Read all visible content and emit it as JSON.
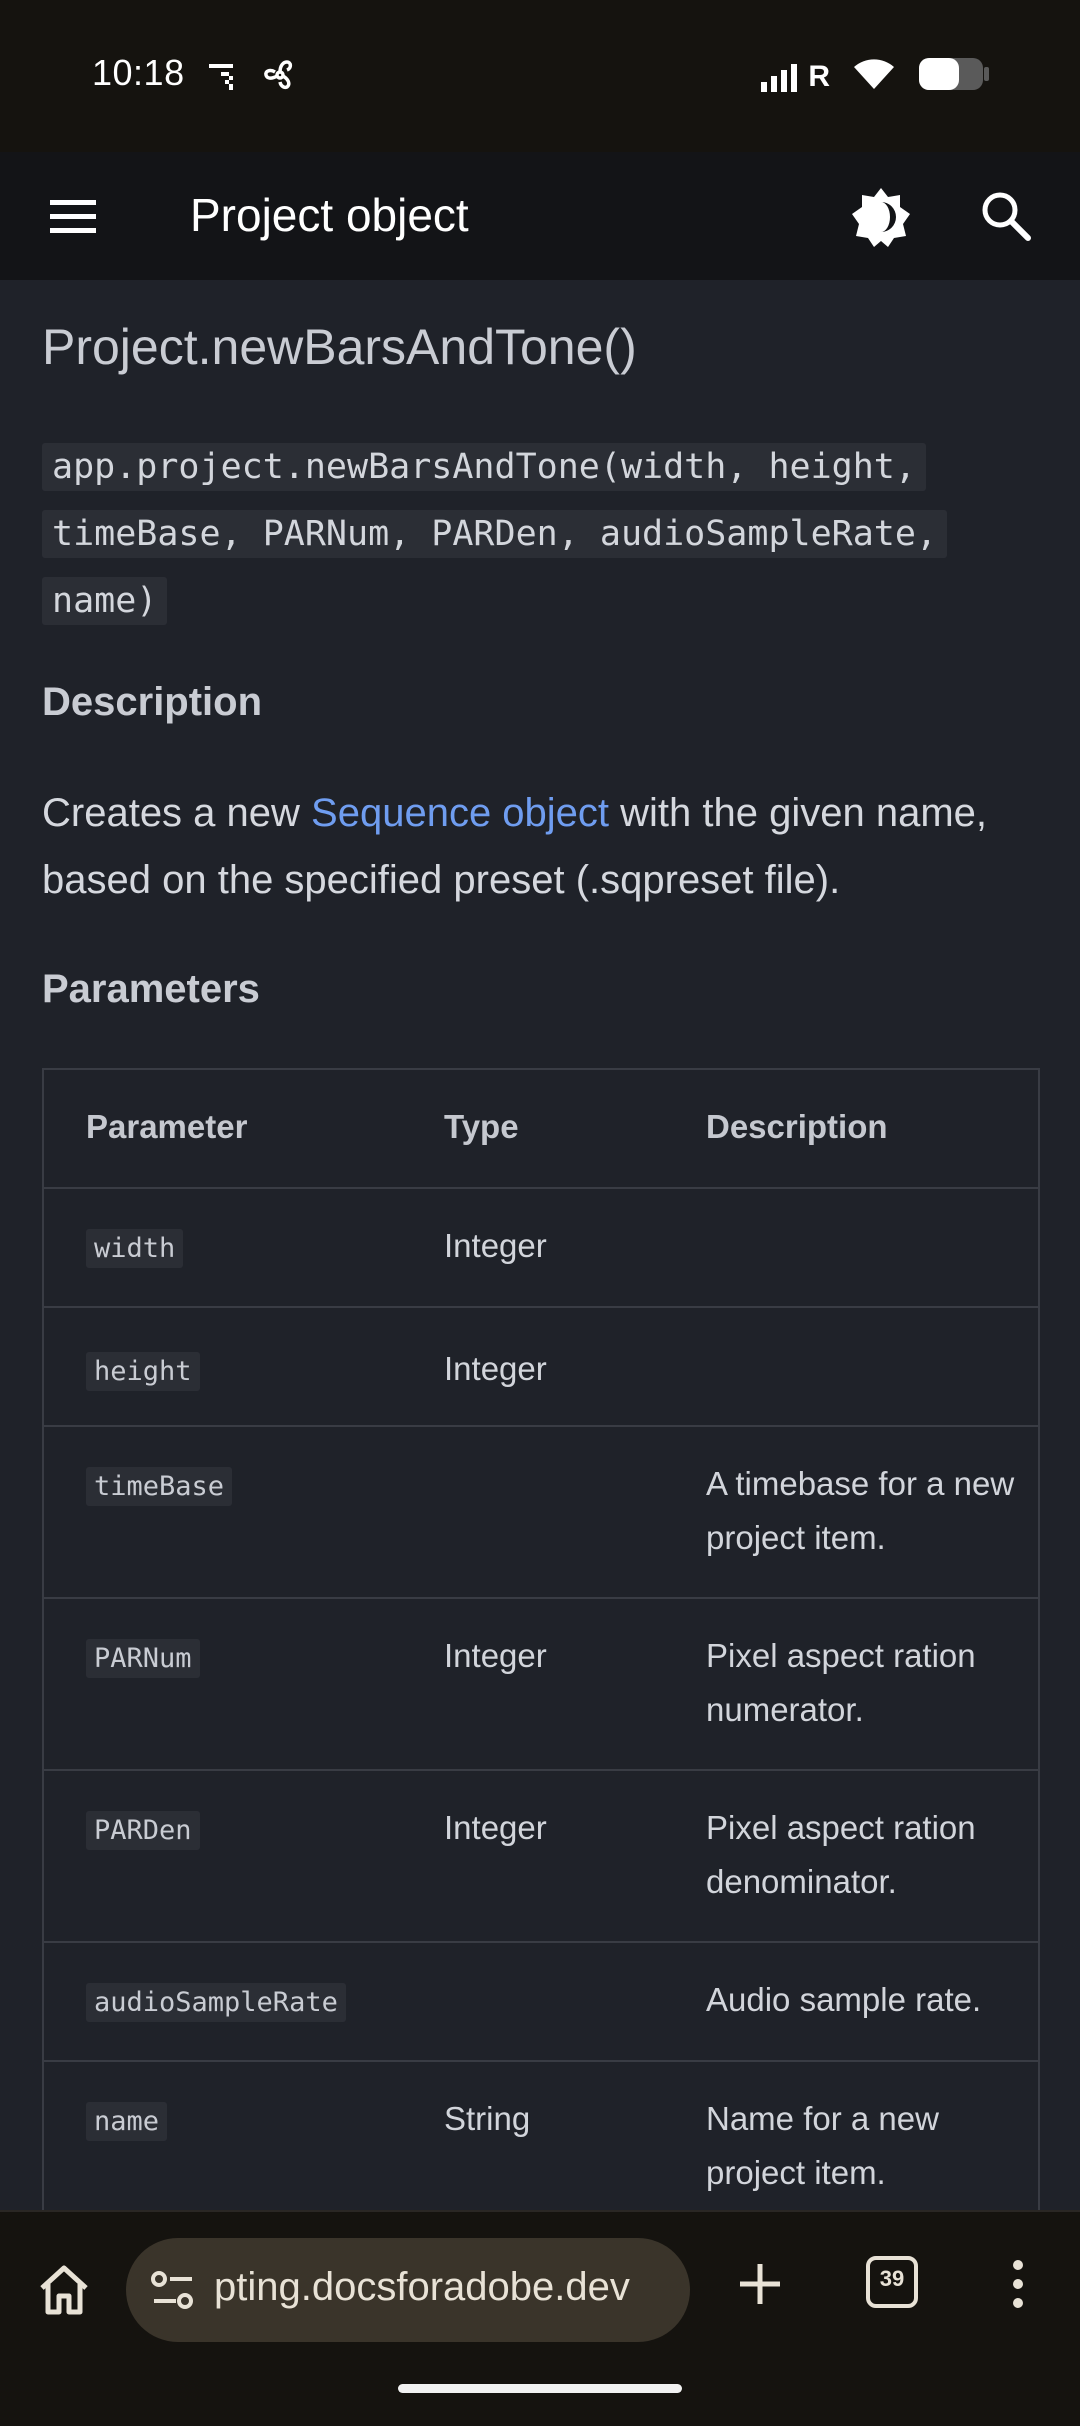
{
  "status": {
    "time": "10:18",
    "left_icons": [
      "notification-icon",
      "fan-icon"
    ],
    "right_icons": [
      "signal-roaming-icon",
      "wifi-icon",
      "battery-icon"
    ],
    "roaming_label": "R"
  },
  "appbar": {
    "title": "Project object",
    "icons": [
      "menu-icon",
      "theme-toggle-icon",
      "search-icon"
    ]
  },
  "content": {
    "heading": "Project.newBarsAndTone()",
    "signature_lines": [
      "app.project.newBarsAndTone(width, height,",
      "timeBase, PARNum, PARDen, audioSampleRate,",
      "name)"
    ],
    "description_heading": "Description",
    "description_prefix": "Creates a new ",
    "description_link": "Sequence object",
    "description_suffix": " with the given name, based on the specified preset (.sqpreset file).",
    "parameters_heading": "Parameters",
    "table": {
      "headers": [
        "Parameter",
        "Type",
        "Description"
      ],
      "rows": [
        {
          "param": "width",
          "type": "Integer",
          "desc": ""
        },
        {
          "param": "height",
          "type": "Integer",
          "desc": ""
        },
        {
          "param": "timeBase",
          "type": "",
          "desc": "A timebase for a new project item."
        },
        {
          "param": "PARNum",
          "type": "Integer",
          "desc": "Pixel aspect ration numerator."
        },
        {
          "param": "PARDen",
          "type": "Integer",
          "desc": "Pixel aspect ration denominator."
        },
        {
          "param": "audioSampleRate",
          "type": "",
          "desc": "Audio sample rate."
        },
        {
          "param": "name",
          "type": "String",
          "desc": "Name for a new project item."
        }
      ]
    }
  },
  "bottombar": {
    "url": "pting.docsforadobe.dev",
    "tab_count": "39",
    "icons": [
      "home-icon",
      "site-settings-icon",
      "new-tab-icon",
      "tabs-icon",
      "more-icon"
    ]
  },
  "colors": {
    "background": "#1f2229",
    "appbar": "#131417",
    "link": "#6f9df0",
    "url_pill": "#3a342a"
  }
}
